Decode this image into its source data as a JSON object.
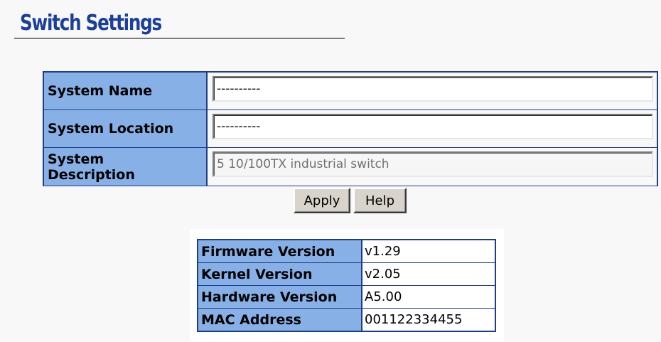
{
  "page": {
    "title": "Switch Settings"
  },
  "settings": {
    "rows": [
      {
        "label": "System Name",
        "value": "----------",
        "editable": true
      },
      {
        "label": "System Location",
        "value": "----------",
        "editable": true
      },
      {
        "label_line1": "System",
        "label_line2": "Description",
        "value": "5 10/100TX industrial switch",
        "editable": false
      }
    ]
  },
  "buttons": {
    "apply_label": "Apply",
    "help_label": "Help"
  },
  "info": {
    "rows": [
      {
        "label": "Firmware Version",
        "value": "v1.29"
      },
      {
        "label": "Kernel Version",
        "value": "v2.05"
      },
      {
        "label": "Hardware Version",
        "value": "A5.00"
      },
      {
        "label": "MAC Address",
        "value": "001122334455"
      }
    ]
  },
  "colors": {
    "title": "#1b3f9a",
    "label_background": "#86b0e6",
    "table_border": "#1e3c8c"
  }
}
